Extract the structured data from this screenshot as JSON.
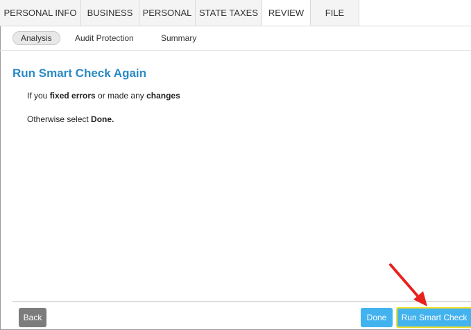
{
  "tabs": [
    {
      "label": "PERSONAL INFO",
      "active": false
    },
    {
      "label": "BUSINESS",
      "active": false
    },
    {
      "label": "PERSONAL",
      "active": false
    },
    {
      "label": "STATE TAXES",
      "active": false
    },
    {
      "label": "REVIEW",
      "active": true
    },
    {
      "label": "FILE",
      "active": false
    }
  ],
  "subtabs": [
    {
      "label": "Analysis",
      "active": true
    },
    {
      "label": "Audit Protection",
      "active": false
    },
    {
      "label": "Summary",
      "active": false
    }
  ],
  "main": {
    "title": "Run Smart Check Again",
    "line1": {
      "pre": "If you ",
      "bold1": "fixed errors",
      "mid": " or made any ",
      "bold2": "changes"
    },
    "line2": {
      "pre": "Otherwise select ",
      "bold": "Done."
    }
  },
  "footer": {
    "back_label": "Back",
    "done_label": "Done",
    "run_label": "Run Smart Check"
  },
  "colors": {
    "accent": "#2a8ac5",
    "button_primary": "#43b3ef",
    "button_secondary": "#7c7c7c",
    "highlight_border": "#f3e22a",
    "annotation_arrow": "#e8211f"
  },
  "icons": {
    "annotation": "red-arrow-icon"
  }
}
